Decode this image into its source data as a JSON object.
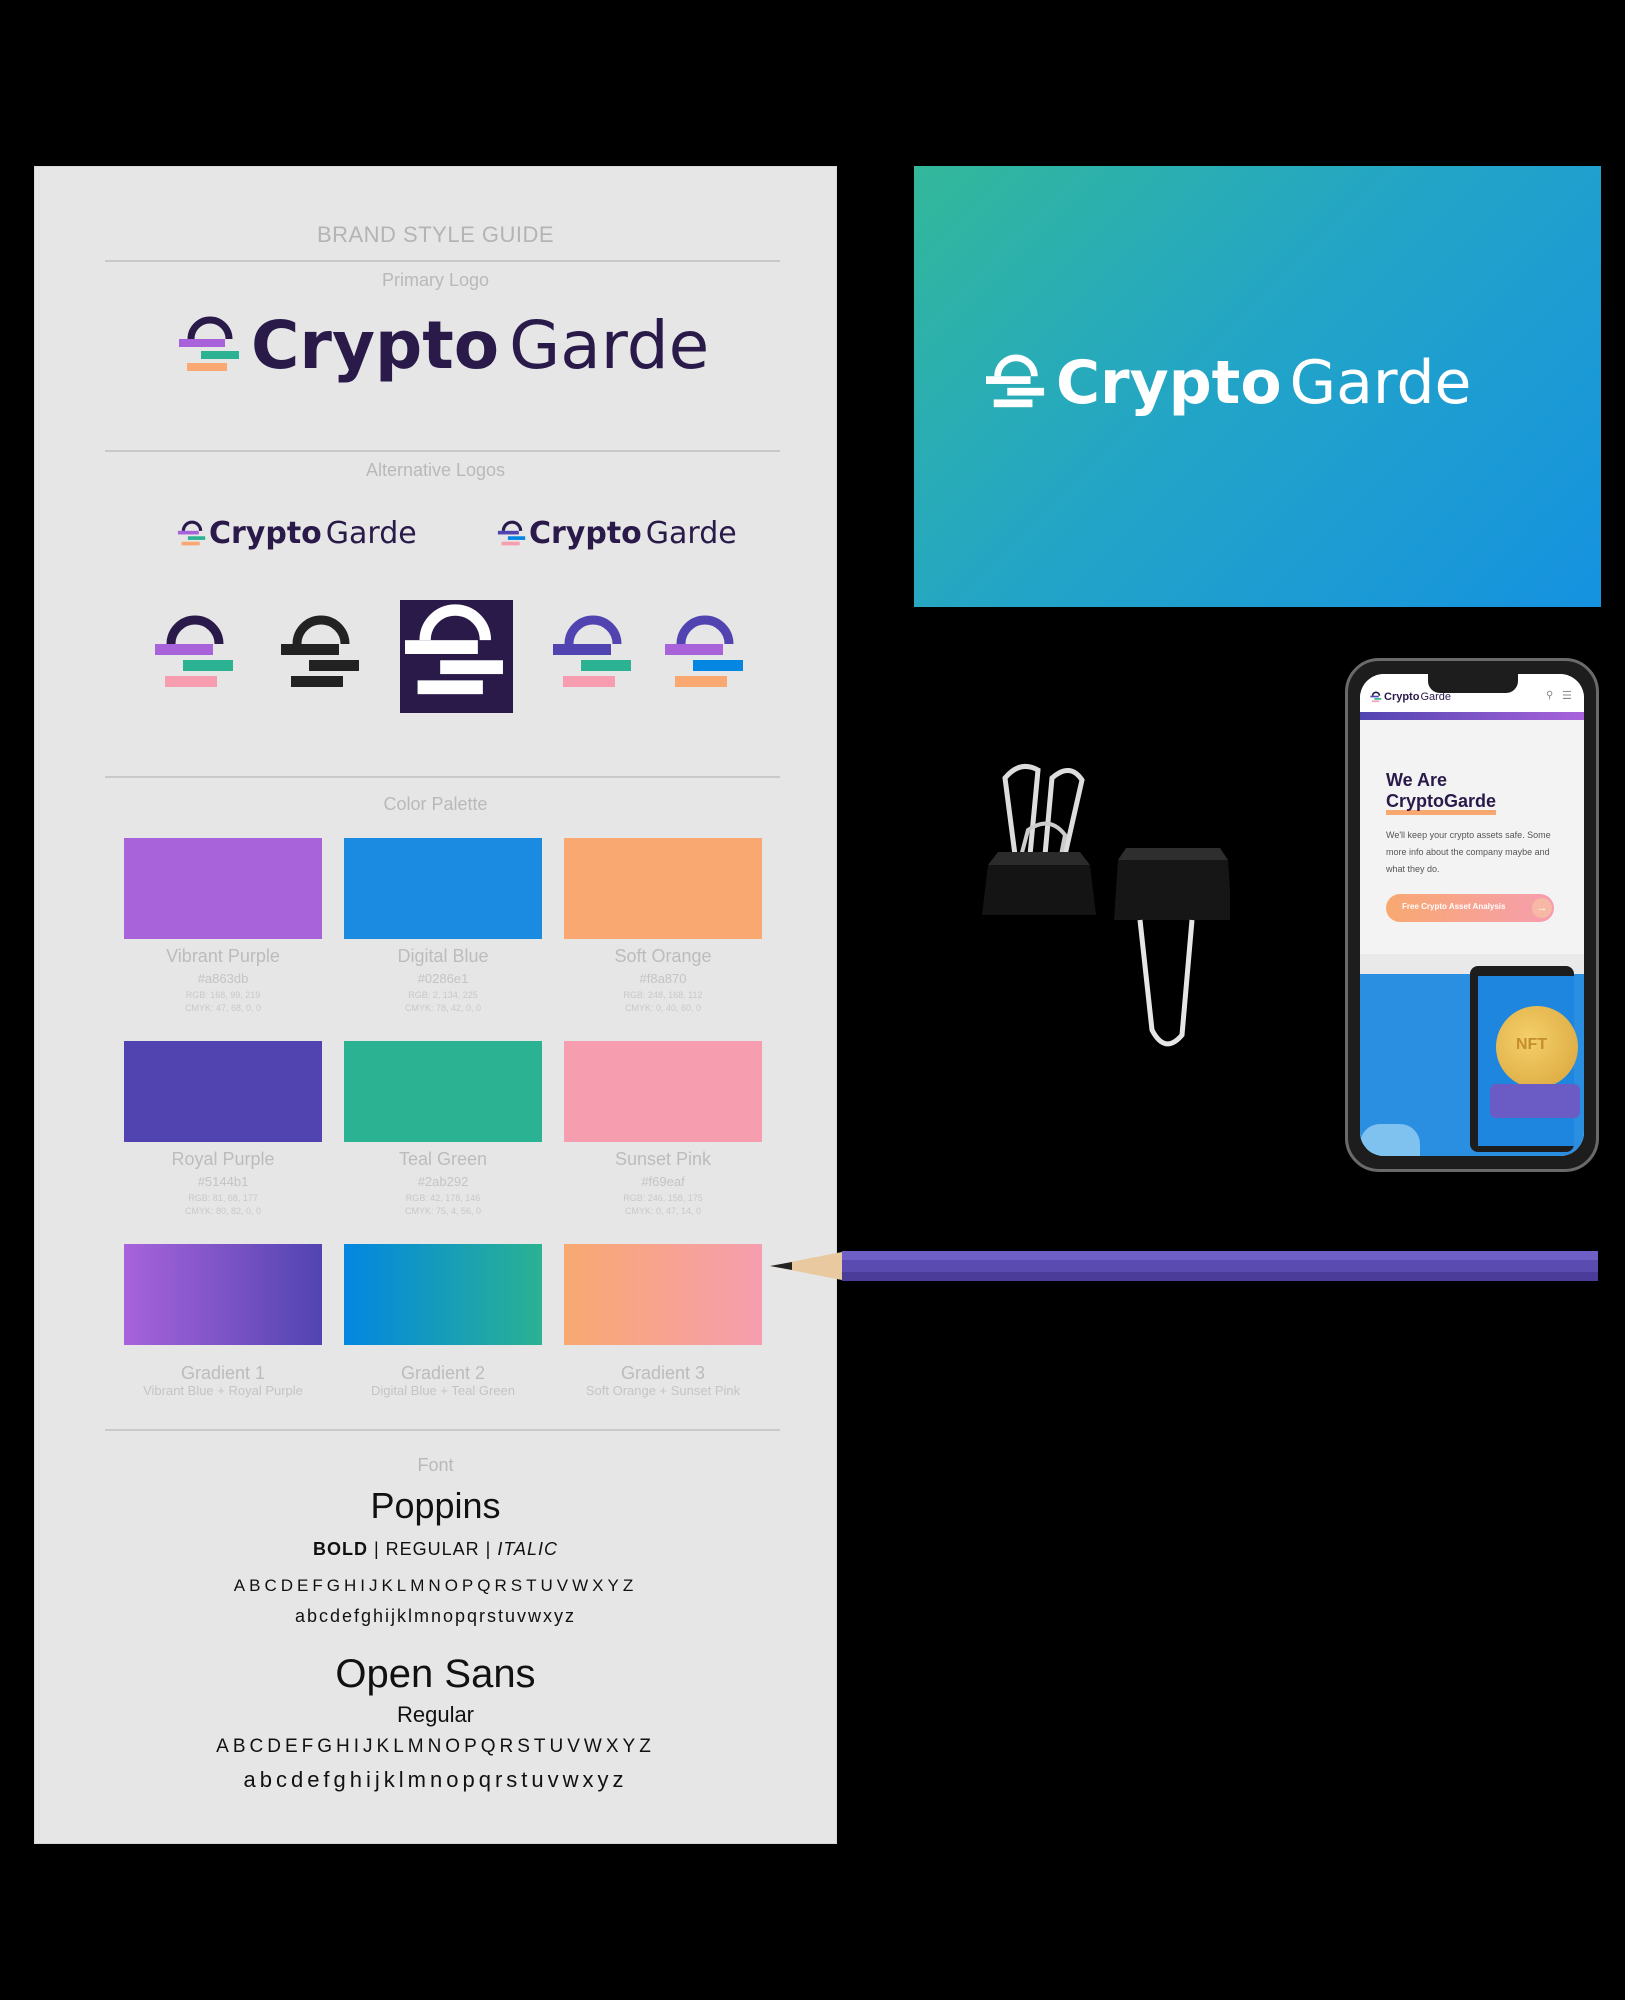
{
  "guide": {
    "title": "BRAND STYLE GUIDE",
    "primary_logo_caption": "Primary Logo",
    "alternative_logos_caption": "Alternative Logos",
    "color_palette_caption": "Color Palette",
    "font_caption": "Font",
    "logo_word_1": "Crypto",
    "logo_word_2": "Garde"
  },
  "palette": [
    {
      "name": "Vibrant Purple",
      "hex_label": "#a863db",
      "rgb": "RGB: 168, 99, 219",
      "cmyk": "CMYK: 47, 68, 0, 0",
      "color": "#a863db"
    },
    {
      "name": "Digital Blue",
      "hex_label": "#0286e1",
      "rgb": "RGB: 2, 134, 225",
      "cmyk": "CMYK: 78, 42, 0, 0",
      "color": "#1a8be0"
    },
    {
      "name": "Soft Orange",
      "hex_label": "#f8a870",
      "rgb": "RGB: 248, 168, 112",
      "cmyk": "CMYK: 0, 40, 60, 0",
      "color": "#f8a870"
    },
    {
      "name": "Royal Purple",
      "hex_label": "#5144b1",
      "rgb": "RGB: 81, 68, 177",
      "cmyk": "CMYK: 80, 82, 0, 0",
      "color": "#5144b1"
    },
    {
      "name": "Teal Green",
      "hex_label": "#2ab292",
      "rgb": "RGB: 42, 178, 146",
      "cmyk": "CMYK: 75, 4, 56, 0",
      "color": "#2ab292"
    },
    {
      "name": "Sunset Pink",
      "hex_label": "#f69eaf",
      "rgb": "RGB: 246, 158, 175",
      "cmyk": "CMYK: 0, 47, 14, 0",
      "color": "#f69eaf"
    }
  ],
  "gradients": [
    {
      "name": "Gradient 1",
      "desc": "Vibrant Blue + Royal Purple",
      "from": "#a863db",
      "to": "#5144b1"
    },
    {
      "name": "Gradient 2",
      "desc": "Digital Blue + Teal Green",
      "from": "#0286e1",
      "to": "#2ab292"
    },
    {
      "name": "Gradient 3",
      "desc": "Soft Orange + Sunset Pink",
      "from": "#f8a870",
      "to": "#f69eaf"
    }
  ],
  "fonts": {
    "primary_name": "Poppins",
    "styles_bold": "BOLD",
    "styles_sep1": " | ",
    "styles_regular": "REGULAR",
    "styles_sep2": " | ",
    "styles_italic": "ITALIC",
    "primary_upper": "ABCDEFGHIJKLMNOPQRSTUVWXYZ",
    "primary_lower": "abcdefghijklmnopqrstuvwxyz",
    "secondary_name": "Open Sans",
    "secondary_style": "Regular",
    "secondary_upper": "ABCDEFGHIJKLMNOPQRSTUVWXYZ",
    "secondary_lower": "abcdefghijklmnopqrstuvwxyz"
  },
  "card": {
    "logo_word_1": "Crypto",
    "logo_word_2": "Garde"
  },
  "phone": {
    "header_word_1": "Crypto",
    "header_word_2": "Garde",
    "headline_1": "We Are",
    "headline_2": "CryptoGarde",
    "body": "We'll keep your crypto assets safe. Some more info about the company maybe and what they do.",
    "cta": "Free Crypto Asset Analysis",
    "cta_arrow": "→",
    "coin_text": "NFT"
  },
  "colors": {
    "logo_dark": "#2a1a4a",
    "accent_purple": "#a863db",
    "accent_blue": "#0286e1",
    "accent_orange": "#f8a870",
    "accent_royal": "#5144b1",
    "accent_teal": "#2ab292",
    "accent_pink": "#f69eaf",
    "pencil": "#5a4bb0"
  }
}
